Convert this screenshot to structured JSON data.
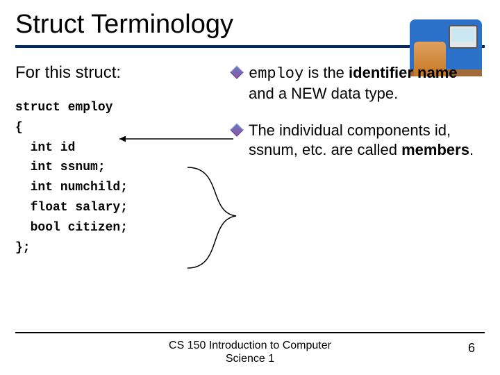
{
  "title": "Struct Terminology",
  "subtitle": "For this struct:",
  "code": {
    "l1": "struct employ",
    "l2": "{",
    "l3": "  int id",
    "l4": "  int ssnum;",
    "l5": "  int numchild;",
    "l6": "  float salary;",
    "l7": "  bool citizen;",
    "l8": "};"
  },
  "bullets": {
    "b1_code": "employ",
    "b1_pre": " is the ",
    "b1_bold1": "identifier name",
    "b1_mid": " and a NEW data type.",
    "b2_pre": "The individual components id, ssnum, etc. are called ",
    "b2_bold": "members",
    "b2_post": "."
  },
  "footer": "CS 150 Introduction to Computer Science 1",
  "page": "6"
}
